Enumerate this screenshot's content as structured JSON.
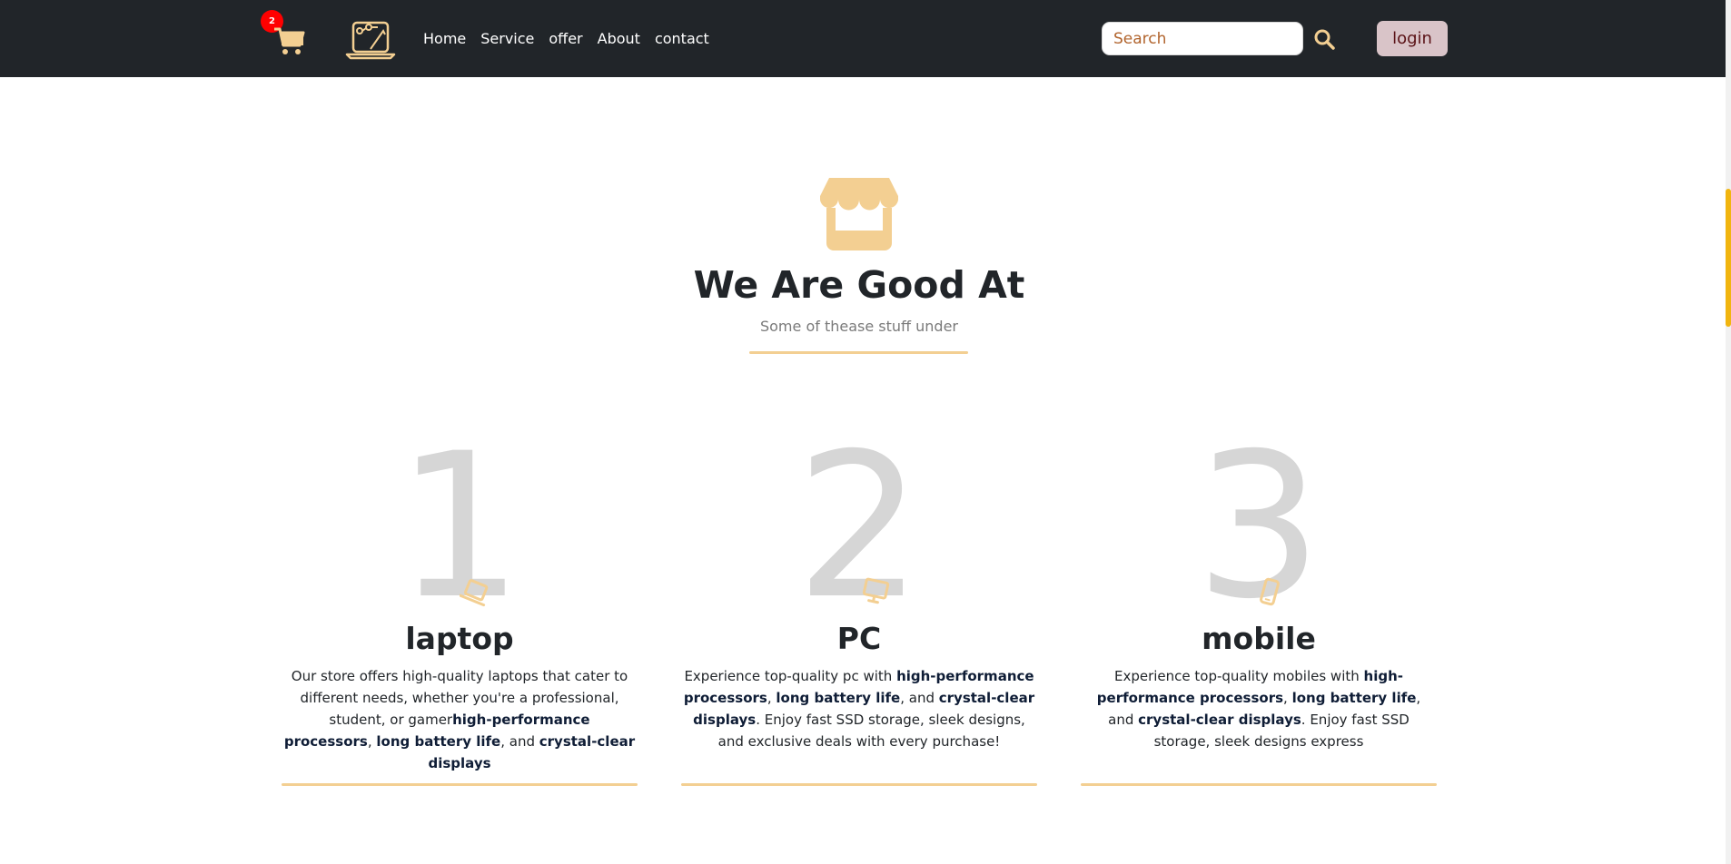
{
  "navbar": {
    "cart_count": "2",
    "links": [
      "Home",
      "Service",
      "offer",
      "About",
      "contact"
    ],
    "search_placeholder": "Search",
    "login_label": "login"
  },
  "colors": {
    "nav_bg": "#212529",
    "accent": "#f3cf92",
    "badge": "#ff0000",
    "login_bg": "#d9c4c8",
    "scroll_thumb": "#f1b50f"
  },
  "hero": {
    "icon": "store-icon",
    "title": "We Are Good At",
    "subtitle": "Some of thease stuff under"
  },
  "cards": [
    {
      "number": "1",
      "title": "laptop",
      "segments": [
        {
          "t": "Our store offers high-quality laptops that cater to different needs, whether you're a professional, student, or gamer",
          "b": false
        },
        {
          "t": "high-performance processors",
          "b": true
        },
        {
          "t": ", ",
          "b": false
        },
        {
          "t": "long battery life",
          "b": true
        },
        {
          "t": ", and ",
          "b": false
        },
        {
          "t": "crystal-clear displays",
          "b": true
        }
      ]
    },
    {
      "number": "2",
      "title": "PC",
      "segments": [
        {
          "t": "Experience top-quality pc with ",
          "b": false
        },
        {
          "t": "high-performance processors",
          "b": true
        },
        {
          "t": ", ",
          "b": false
        },
        {
          "t": "long battery life",
          "b": true
        },
        {
          "t": ", and ",
          "b": false
        },
        {
          "t": "crystal-clear displays",
          "b": true
        },
        {
          "t": ". Enjoy fast SSD storage, sleek designs, and exclusive deals with every purchase!",
          "b": false
        }
      ]
    },
    {
      "number": "3",
      "title": "mobile",
      "segments": [
        {
          "t": "Experience top-quality mobiles with ",
          "b": false
        },
        {
          "t": "high-performance processors",
          "b": true
        },
        {
          "t": ", ",
          "b": false
        },
        {
          "t": "long battery life",
          "b": true
        },
        {
          "t": ", and ",
          "b": false
        },
        {
          "t": "crystal-clear displays",
          "b": true
        },
        {
          "t": ". Enjoy fast SSD storage, sleek designs express",
          "b": false
        }
      ]
    }
  ]
}
